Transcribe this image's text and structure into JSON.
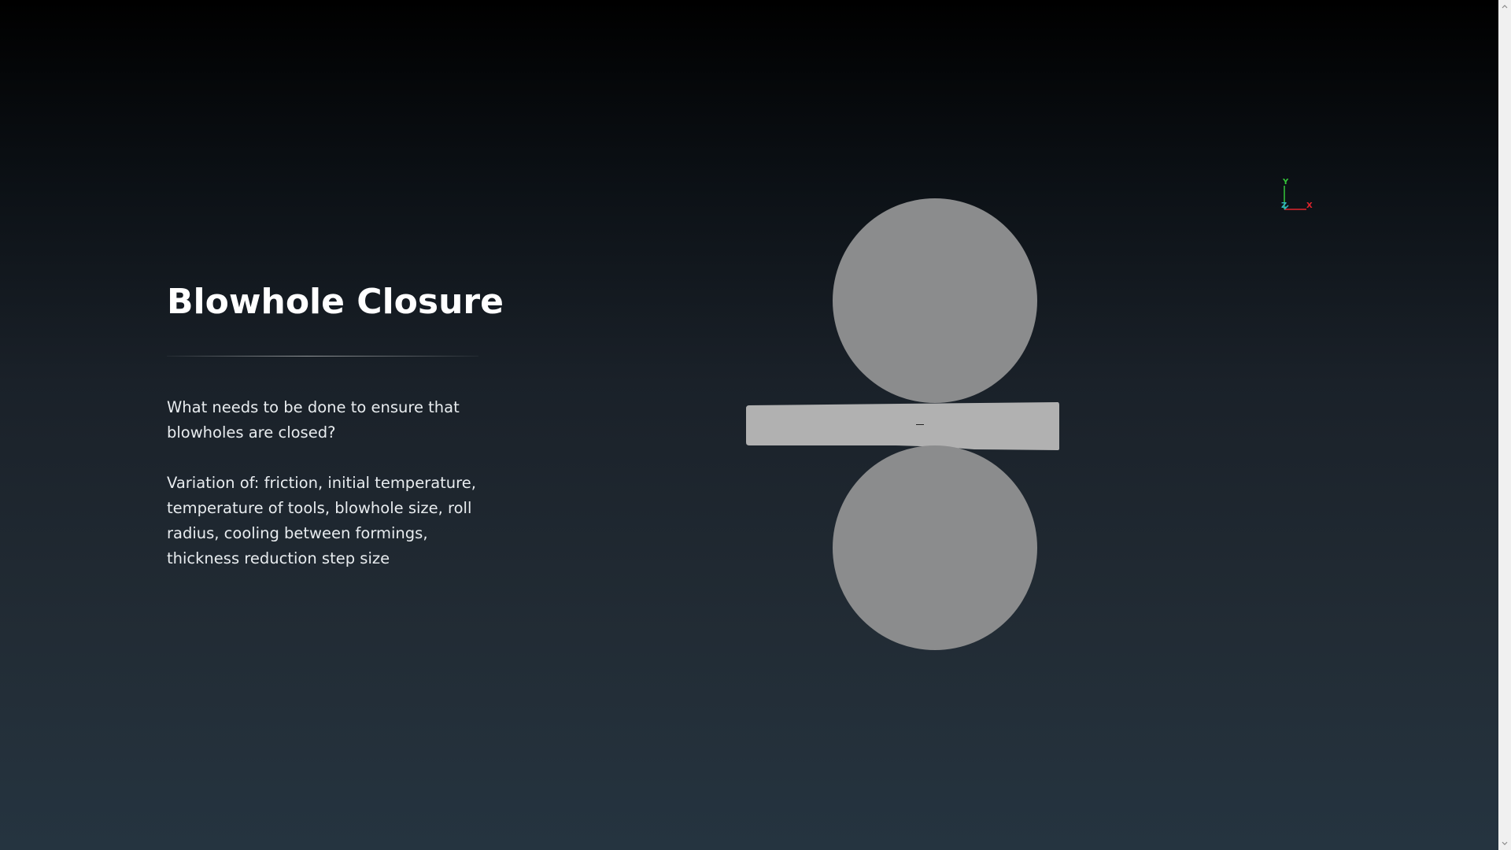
{
  "slide": {
    "title": "Blowhole Closure",
    "question": "What needs to be done to ensure that blowholes are closed?",
    "variation": "Variation of: friction, initial temperature, temperature of tools, blowhole size, roll radius, cooling between formings, thickness reduction step size"
  },
  "axes": {
    "x_label": "X",
    "y_label": "Y",
    "z_label": "Z",
    "x_color": "#e0242d",
    "y_color": "#35c73a",
    "z_color": "#2fb3c4"
  },
  "colors": {
    "roll": "#8b8c8d",
    "workpiece": "#b1b1b1"
  },
  "icons": {
    "scroll_up": "chevron-up-icon",
    "scroll_down": "chevron-down-icon"
  }
}
